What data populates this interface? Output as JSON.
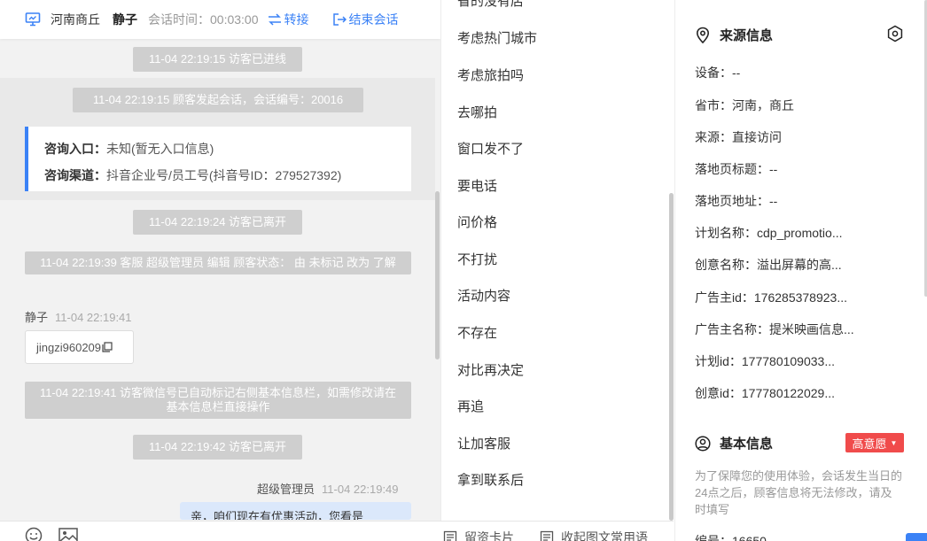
{
  "header": {
    "region": "河南商丘",
    "agent": "静子",
    "session_label": "会话时间：",
    "session_time": "00:03:00",
    "transfer": "转接",
    "end_session": "结束会话"
  },
  "chat": {
    "sys_enter": "11-04 22:19:15 访客已进线",
    "sys_start": "11-04 22:19:15 顾客发起会话，会话编号：20016",
    "entry_label": "咨询入口：",
    "entry_value": "未知(暂无入口信息)",
    "channel_label": "咨询渠道：",
    "channel_value": "抖音企业号/员工号(抖音号ID：279527392)",
    "sys_left1": "11-04 22:19:24 访客已离开",
    "sys_status": "11-04 22:19:39 客服 超级管理员 编辑 顾客状态： 由 未标记 改为 了解",
    "sender1_name": "静子",
    "sender1_time": "11-04 22:19:41",
    "wechat_id": "jingzi960209",
    "sys_wechat": "11-04 22:19:41 访客微信号已自动标记右侧基本信息栏，如需修改请在基本信息栏直接操作",
    "sys_left2": "11-04 22:19:42 访客已离开",
    "sender2_name": "超级管理员",
    "sender2_time": "11-04 22:19:49",
    "bubble_partial": "亲，咱们现在有优惠活动，您看是"
  },
  "toolbar": {
    "emoji_icon": "smile-icon",
    "image_icon": "image-icon",
    "card_label": "留资卡片",
    "phrase_label": "收起图文常用语"
  },
  "phrases": {
    "items": [
      "省的没有店",
      "考虑热门城市",
      "考虑旅拍吗",
      "去哪拍",
      "窗口发不了",
      "要电话",
      "问价格",
      "不打扰",
      "活动内容",
      "不存在",
      "对比再决定",
      "再追",
      "让加客服",
      "拿到联系后"
    ]
  },
  "source_info": {
    "title": "来源信息",
    "rows": [
      "设备：--",
      "省市：河南，商丘",
      "来源：直接访问",
      "落地页标题：--",
      "落地页地址：--",
      "计划名称：cdp_promotio...",
      "创意名称：溢出屏幕的高...",
      "广告主id：176285378923...",
      "广告主名称：提米映画信息...",
      "计划id：177780109033...",
      "创意id：177780122029..."
    ]
  },
  "basic_info": {
    "title": "基本信息",
    "intent": "高意愿",
    "note": "为了保障您的使用体验，会话发生当日的24点之后，顾客信息将无法修改，请及时填写",
    "id_label": "编号：",
    "id_value": "16650"
  },
  "colors": {
    "accent": "#3b82f6",
    "danger": "#f04b4b",
    "system_msg": "#cfcfcf"
  }
}
